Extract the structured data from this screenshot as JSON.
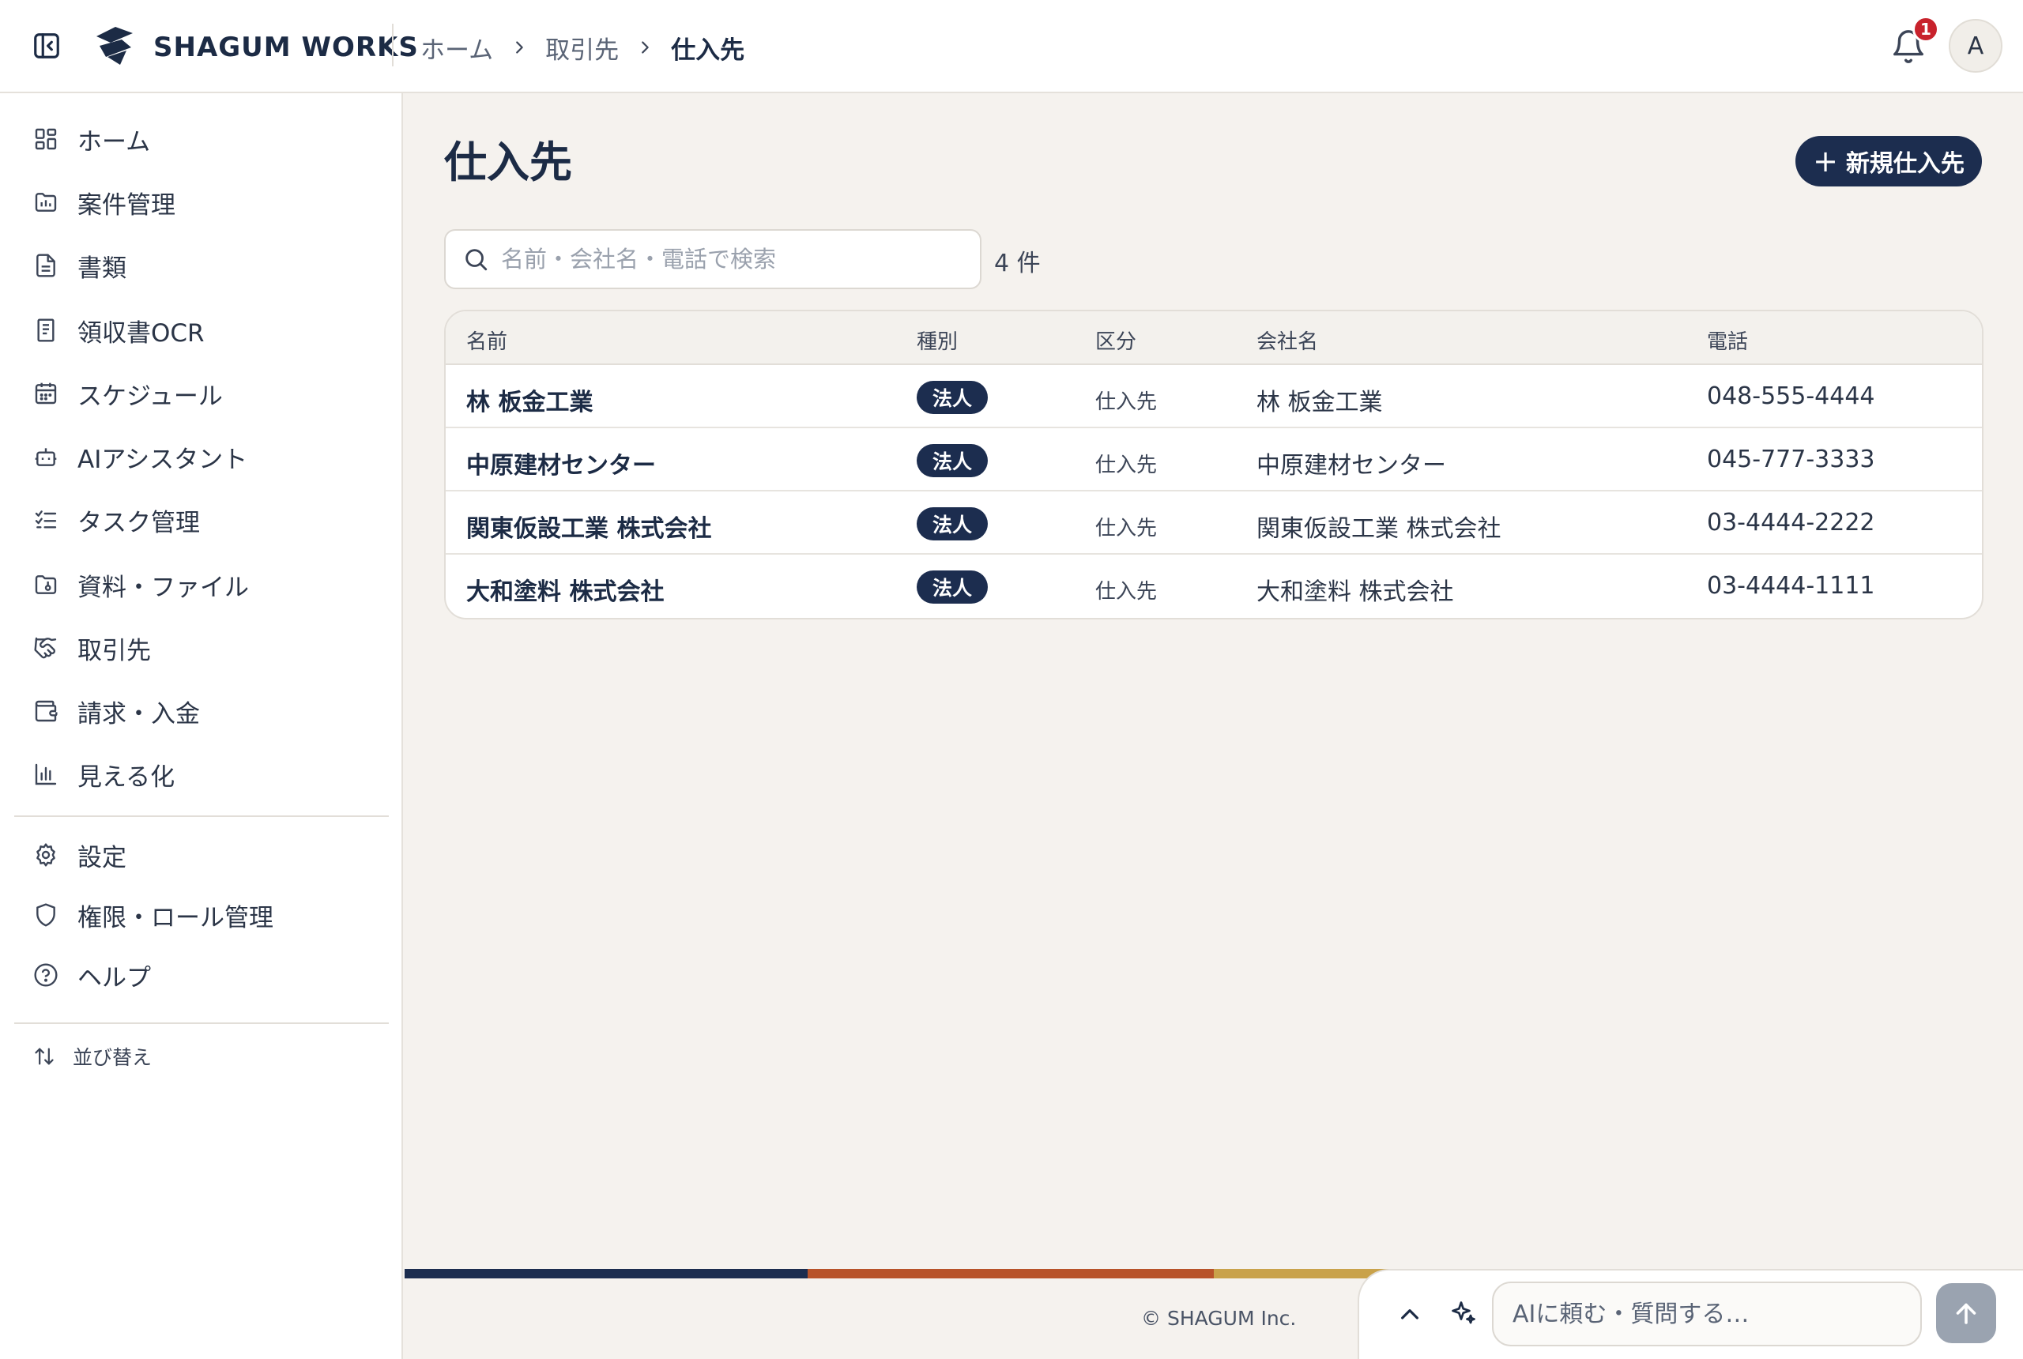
{
  "app": {
    "brand": "SHAGUM WORKS"
  },
  "header": {
    "breadcrumb": [
      "ホーム",
      "取引先",
      "仕入先"
    ],
    "notification_count": "1",
    "avatar_initial": "A"
  },
  "sidebar": {
    "items": [
      {
        "label": "ホーム",
        "icon": "dashboard-icon"
      },
      {
        "label": "案件管理",
        "icon": "folder-chart-icon"
      },
      {
        "label": "書類",
        "icon": "document-icon"
      },
      {
        "label": "領収書OCR",
        "icon": "receipt-icon"
      },
      {
        "label": "スケジュール",
        "icon": "calendar-icon"
      },
      {
        "label": "AIアシスタント",
        "icon": "bot-icon"
      },
      {
        "label": "タスク管理",
        "icon": "task-list-icon"
      },
      {
        "label": "資料・ファイル",
        "icon": "folder-file-icon"
      },
      {
        "label": "取引先",
        "icon": "handshake-icon"
      },
      {
        "label": "請求・入金",
        "icon": "wallet-icon"
      },
      {
        "label": "見える化",
        "icon": "bar-chart-icon"
      }
    ],
    "bottom_items": [
      {
        "label": "設定",
        "icon": "gear-icon"
      },
      {
        "label": "権限・ロール管理",
        "icon": "shield-icon"
      },
      {
        "label": "ヘルプ",
        "icon": "help-icon"
      }
    ],
    "sort_label": "並び替え"
  },
  "main": {
    "title": "仕入先",
    "new_button": "新規仕入先",
    "search_placeholder": "名前・会社名・電話で検索",
    "count": "4 件",
    "columns": [
      "名前",
      "種別",
      "区分",
      "会社名",
      "電話"
    ],
    "rows": [
      {
        "name": "林 板金工業",
        "type": "法人",
        "category": "仕入先",
        "company": "林 板金工業",
        "phone": "048-555-4444"
      },
      {
        "name": "中原建材センター",
        "type": "法人",
        "category": "仕入先",
        "company": "中原建材センター",
        "phone": "045-777-3333"
      },
      {
        "name": "関東仮設工業 株式会社",
        "type": "法人",
        "category": "仕入先",
        "company": "関東仮設工業 株式会社",
        "phone": "03-4444-2222"
      },
      {
        "name": "大和塗料 株式会社",
        "type": "法人",
        "category": "仕入先",
        "company": "大和塗料 株式会社",
        "phone": "03-4444-1111"
      }
    ]
  },
  "footer": {
    "copyright": "© SHAGUM Inc.",
    "stripe_colors": [
      "#1c2d4f",
      "#b8532a",
      "#c9a24a"
    ]
  },
  "ai_bar": {
    "placeholder": "AIに頼む・質問する…"
  },
  "colors": {
    "primary": "#1c2d4f",
    "badge": "#c8222c",
    "background": "#f5f2ee"
  }
}
